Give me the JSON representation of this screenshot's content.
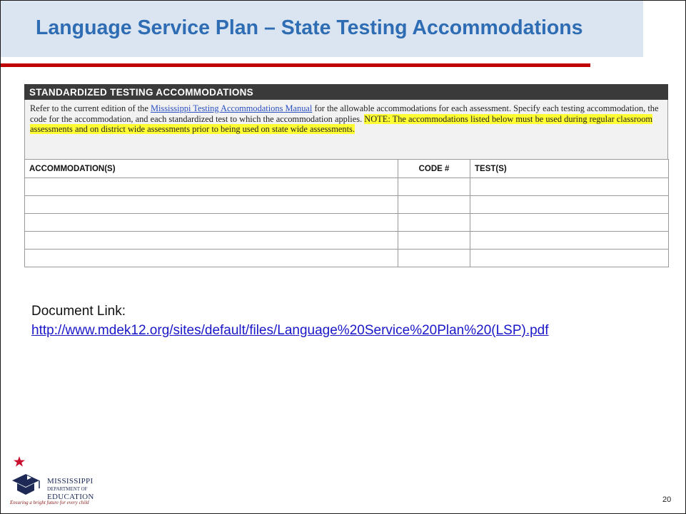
{
  "slide": {
    "title": "Language Service Plan – State Testing Accommodations",
    "page_number": "20"
  },
  "document": {
    "header": "STANDARDIZED TESTING ACCOMMODATIONS",
    "intro_before_link": "Refer to the current edition of the ",
    "intro_link": "Mississippi Testing Accommodations Manual",
    "intro_after_link": " for the allowable accommodations for each assessment. Specify each testing accommodation, the code for the accommodation, and each standardized test to which the accommodation applies. ",
    "intro_note": "NOTE: The accommodations listed below must be used during regular classroom assessments and on district wide assessments prior to being used on state wide assessments.",
    "table": {
      "headers": [
        "ACCOMMODATION(S)",
        "CODE #",
        "TEST(S)"
      ],
      "rows": [
        [
          "",
          "",
          ""
        ],
        [
          "",
          "",
          ""
        ],
        [
          "",
          "",
          ""
        ],
        [
          "",
          "",
          ""
        ],
        [
          "",
          "",
          ""
        ]
      ]
    }
  },
  "document_link": {
    "label": "Document Link:",
    "url": "http://www.mdek12.org/sites/default/files/Language%20Service%20Plan%20(LSP).pdf"
  },
  "logo": {
    "line1": "MISSISSIPPI",
    "line2": "DEPARTMENT OF",
    "line3": "EDUCATION",
    "tagline": "Ensuring a bright future for every child",
    "colors": {
      "navy": "#1e2a55",
      "red": "#c8102e"
    }
  }
}
